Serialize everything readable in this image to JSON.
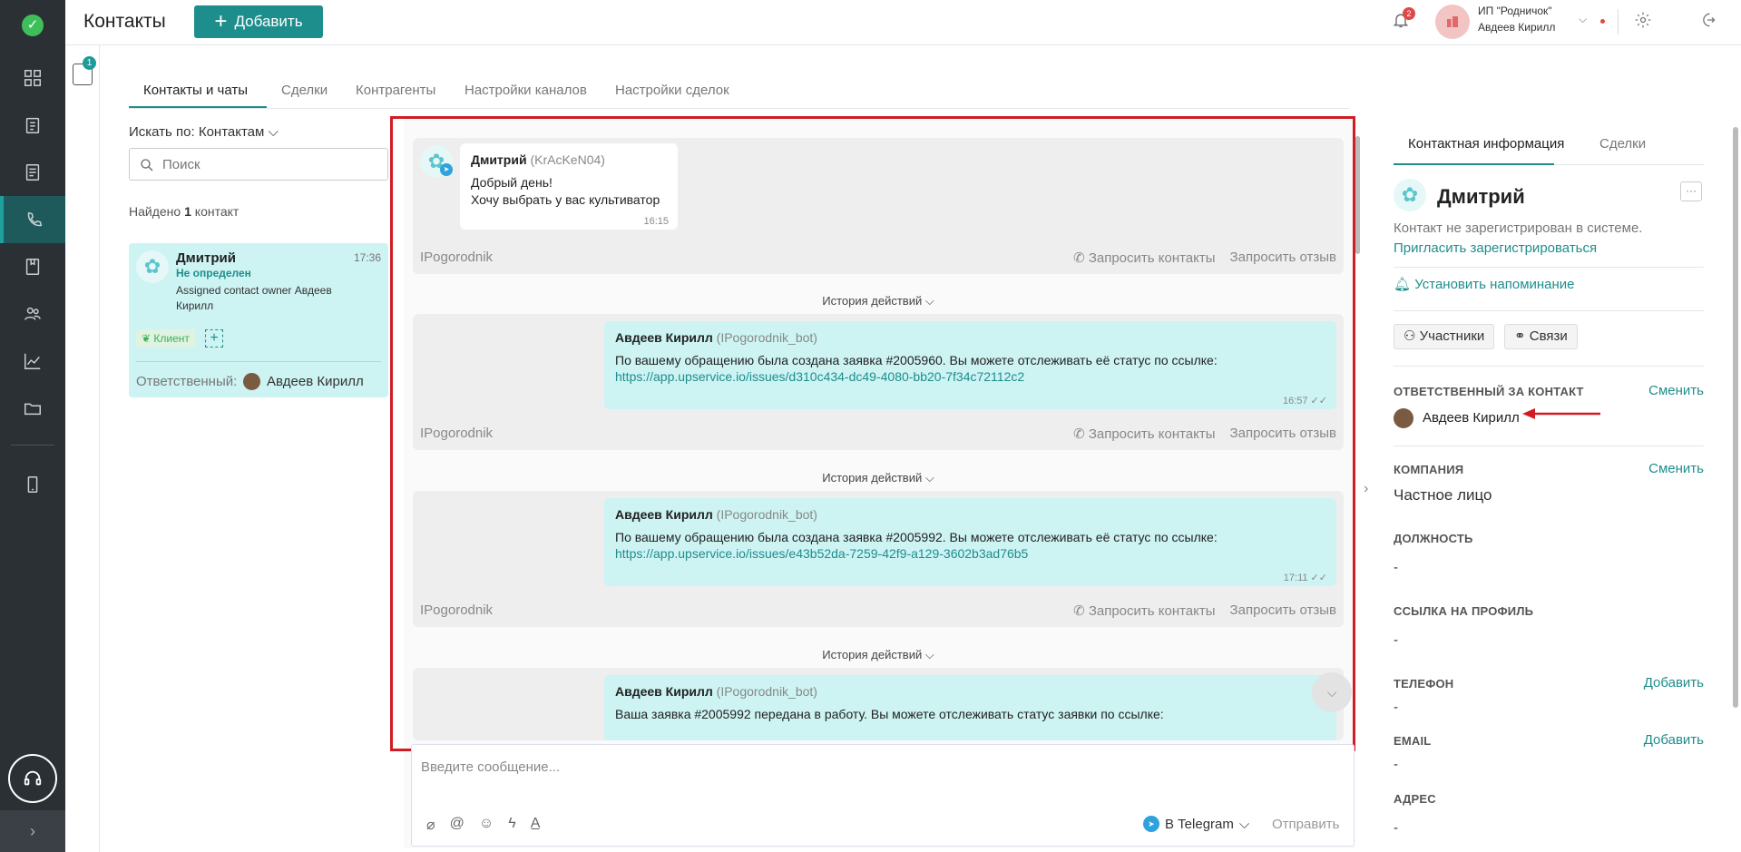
{
  "header": {
    "title": "Контакты",
    "add_label": "Добавить",
    "notif_count": "2",
    "org_name": "ИП \"Родничок\"",
    "org_user": "Авдеев Кирилл"
  },
  "filter_badge": "1",
  "tabs": [
    {
      "label": "Контакты и чаты"
    },
    {
      "label": "Сделки"
    },
    {
      "label": "Контрагенты"
    },
    {
      "label": "Настройки каналов"
    },
    {
      "label": "Настройки сделок"
    }
  ],
  "list": {
    "search_by": "Искать по: Контактам",
    "search_placeholder": "Поиск",
    "found_prefix": "Найдено",
    "found_count": "1",
    "found_suffix": "контакт",
    "card": {
      "name": "Дмитрий",
      "time": "17:36",
      "status": "Не определен",
      "description": "Assigned contact owner Авдеев Кирилл",
      "tag": "Клиент",
      "resp_label": "Ответственный:",
      "resp_name": "Авдеев Кирилл"
    }
  },
  "chat": {
    "history_label": "История действий",
    "request_contacts": "Запросить контакты",
    "request_review": "Запросить отзыв",
    "channel_account": "IPogorodnik",
    "messages": [
      {
        "author": "Дмитрий",
        "nick": "(KrAcKeN04)",
        "line1": "Добрый день!",
        "line2": "Хочу выбрать у вас культиватор",
        "time": "16:15"
      },
      {
        "author": "Авдеев Кирилл",
        "nick": "(IPogorodnik_bot)",
        "text": "По вашему обращению была создана заявка #2005960. Вы можете отслеживать её статус по ссылке:",
        "link": "https://app.upservice.io/issues/d310c434-dc49-4080-bb20-7f34c72112c2",
        "time": "16:57"
      },
      {
        "author": "Авдеев Кирилл",
        "nick": "(IPogorodnik_bot)",
        "text": "По вашему обращению была создана заявка #2005992. Вы можете отслеживать её статус по ссылке:",
        "link": "https://app.upservice.io/issues/e43b52da-7259-42f9-a129-3602b3ad76b5",
        "time": "17:11"
      },
      {
        "author": "Авдеев Кирилл",
        "nick": "(IPogorodnik_bot)",
        "text": "Ваша заявка #2005992 передана в работу. Вы можете отслеживать статус заявки по ссылке:"
      }
    ],
    "composer_placeholder": "Введите сообщение...",
    "channel_select": "В Telegram",
    "send_label": "Отправить"
  },
  "info": {
    "tab_info": "Контактная информация",
    "tab_deals": "Сделки",
    "name": "Дмитрий",
    "not_registered": "Контакт не зарегистрирован в системе.",
    "invite": "Пригласить зарегистрироваться",
    "reminder": "Установить напоминание",
    "participants": "Участники",
    "links": "Связи",
    "responsible_label": "ОТВЕТСТВЕННЫЙ ЗА КОНТАКТ",
    "change": "Сменить",
    "responsible_name": "Авдеев Кирилл",
    "company_label": "КОМПАНИЯ",
    "company_value": "Частное лицо",
    "position_label": "ДОЛЖНОСТЬ",
    "profile_label": "ССЫЛКА НА ПРОФИЛЬ",
    "phone_label": "ТЕЛЕФОН",
    "email_label": "EMAIL",
    "address_label": "АДРЕС",
    "add": "Добавить",
    "empty": "-"
  },
  "colors": {
    "accent": "#1e8e8c",
    "highlight_frame": "#d11c25",
    "sidebar": "#2b3034"
  }
}
